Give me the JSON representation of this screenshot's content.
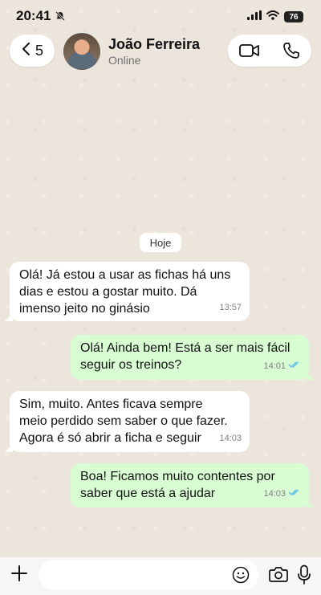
{
  "status_bar": {
    "time": "20:41",
    "battery": "76"
  },
  "header": {
    "back_count": "5",
    "contact_name": "João Ferreira",
    "contact_status": "Online"
  },
  "chat": {
    "date_label": "Hoje",
    "messages": [
      {
        "direction": "incoming",
        "lines": [
          "Olá! Já estou a usar as fichas há uns",
          "dias e estou a gostar muito. Dá",
          "imenso jeito no ginásio"
        ],
        "time": "13:57"
      },
      {
        "direction": "outgoing",
        "lines": [
          "Olá! Ainda bem! Está a ser mais fácil",
          "seguir os treinos?"
        ],
        "time": "14:01",
        "read": true
      },
      {
        "direction": "incoming",
        "lines": [
          "Sim, muito. Antes ficava sempre",
          "meio perdido sem saber o que fazer.",
          "Agora é só abrir a ficha e seguir"
        ],
        "time": "14:03"
      },
      {
        "direction": "outgoing",
        "lines": [
          "Boa! Ficamos muito contentes por",
          "saber que está a ajudar"
        ],
        "time": "14:03",
        "read": true
      }
    ]
  },
  "composer": {
    "placeholder": ""
  },
  "colors": {
    "outgoing_bubble": "#d9fdd3",
    "incoming_bubble": "#ffffff",
    "read_ticks": "#53bdeb"
  }
}
